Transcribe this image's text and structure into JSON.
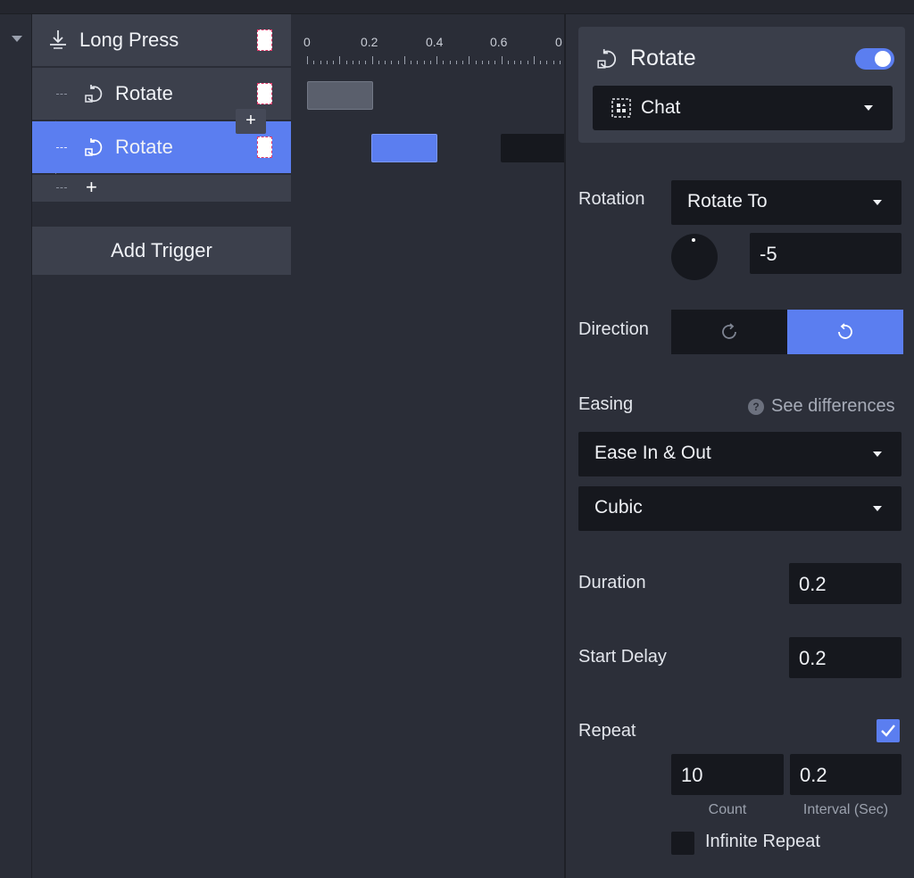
{
  "triggers": {
    "trigger_label": "Long Press",
    "actions": [
      {
        "label": "Rotate"
      },
      {
        "label": "Rotate"
      }
    ],
    "add_action_plus": "+",
    "insert_plus": "+",
    "add_trigger_label": "Add Trigger"
  },
  "timeline": {
    "ticks": [
      "0",
      "0.2",
      "0.4",
      "0.6",
      "0"
    ]
  },
  "inspector": {
    "title": "Rotate",
    "enabled": true,
    "target": "Chat",
    "rotation_label": "Rotation",
    "rotation_mode": "Rotate To",
    "rotation_value": "-5",
    "direction_label": "Direction",
    "direction_selected": "counter-clockwise",
    "easing_label": "Easing",
    "see_differences": "See differences",
    "easing_type": "Ease In & Out",
    "easing_curve": "Cubic",
    "duration_label": "Duration",
    "duration_value": "0.2",
    "start_delay_label": "Start Delay",
    "start_delay_value": "0.2",
    "repeat_label": "Repeat",
    "repeat_checked": true,
    "repeat_count": "10",
    "repeat_interval": "0.2",
    "count_label": "Count",
    "interval_label": "Interval (Sec)",
    "infinite_repeat_label": "Infinite Repeat",
    "infinite_repeat_checked": false
  },
  "colors": {
    "accent": "#5b7ef0",
    "panel": "#2c2f39",
    "field": "#16181e"
  }
}
